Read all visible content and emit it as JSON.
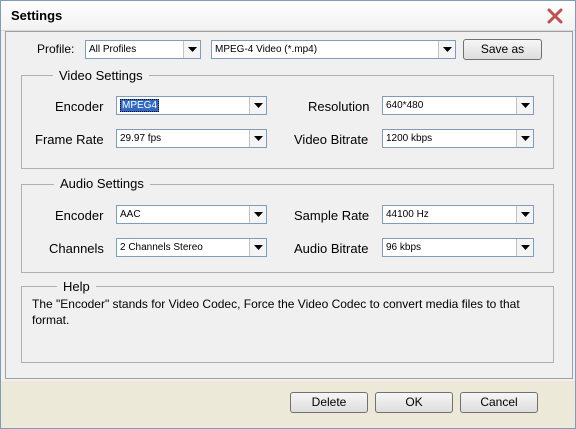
{
  "window": {
    "title": "Settings"
  },
  "profile": {
    "label": "Profile:",
    "category": "All Profiles",
    "format": "MPEG-4 Video (*.mp4)",
    "save_as": "Save as"
  },
  "video": {
    "title": "Video Settings",
    "encoder_label": "Encoder",
    "encoder": "MPEG4",
    "resolution_label": "Resolution",
    "resolution": "640*480",
    "frame_rate_label": "Frame Rate",
    "frame_rate": "29.97 fps",
    "bitrate_label": "Video Bitrate",
    "bitrate": "1200 kbps"
  },
  "audio": {
    "title": "Audio Settings",
    "encoder_label": "Encoder",
    "encoder": "AAC",
    "sample_rate_label": "Sample Rate",
    "sample_rate": "44100 Hz",
    "channels_label": "Channels",
    "channels": "2 Channels Stereo",
    "bitrate_label": "Audio Bitrate",
    "bitrate": "96 kbps"
  },
  "help": {
    "title": "Help",
    "text": "The \"Encoder\" stands for Video Codec, Force the Video Codec to convert media files to that format."
  },
  "buttons": {
    "delete": "Delete",
    "ok": "OK",
    "cancel": "Cancel"
  },
  "colors": {
    "accent": "#316ac5",
    "close_icon": "#c0504d"
  }
}
